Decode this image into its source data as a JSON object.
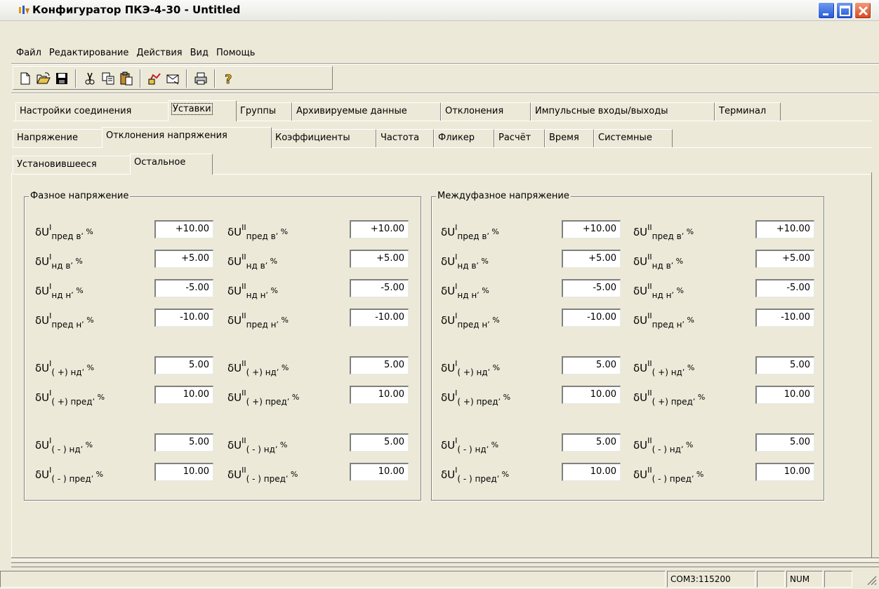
{
  "window": {
    "title": "Конфигуратор ПКЭ-4-30 - Untitled"
  },
  "menu": [
    "Файл",
    "Редактирование",
    "Действия",
    "Вид",
    "Помощь"
  ],
  "toolbar": {
    "icons": [
      "new-file-icon",
      "open-folder-icon",
      "save-icon",
      "cut-icon",
      "copy-icon",
      "paste-icon",
      "read-device-icon",
      "write-device-icon",
      "print-icon",
      "help-icon"
    ]
  },
  "tabs_main": [
    "Настройки соединения",
    "Уставки",
    "Группы",
    "Архивируемые данные",
    "Отклонения",
    "Импульсные входы/выходы",
    "Терминал"
  ],
  "tabs_sub": [
    "Напряжение",
    "Отклонения напряжения",
    "Коэффициенты",
    "Частота",
    "Фликер",
    "Расчёт",
    "Время",
    "Системные"
  ],
  "tabs_inner": [
    "Установившееся",
    "Остальное"
  ],
  "groups": {
    "phase": {
      "label": "Фазное напряжение",
      "values": {
        "pred_v_1": "+10.00",
        "pred_v_2": "+10.00",
        "nd_v_1": "+5.00",
        "nd_v_2": "+5.00",
        "nd_n_1": "-5.00",
        "nd_n_2": "-5.00",
        "pred_n_1": "-10.00",
        "pred_n_2": "-10.00",
        "plus_nd_1": "5.00",
        "plus_nd_2": "5.00",
        "plus_pred_1": "10.00",
        "plus_pred_2": "10.00",
        "minus_nd_1": "5.00",
        "minus_nd_2": "5.00",
        "minus_pred_1": "10.00",
        "minus_pred_2": "10.00"
      }
    },
    "interphase": {
      "label": "Междуфазное напряжение",
      "values": {
        "pred_v_1": "+10.00",
        "pred_v_2": "+10.00",
        "nd_v_1": "+5.00",
        "nd_v_2": "+5.00",
        "nd_n_1": "-5.00",
        "nd_n_2": "-5.00",
        "pred_n_1": "-10.00",
        "pred_n_2": "-10.00",
        "plus_nd_1": "5.00",
        "plus_nd_2": "5.00",
        "plus_pred_1": "10.00",
        "plus_pred_2": "10.00",
        "minus_nd_1": "5.00",
        "minus_nd_2": "5.00",
        "minus_pred_1": "10.00",
        "minus_pred_2": "10.00"
      }
    }
  },
  "labels": {
    "delta_u": "δU",
    "sup_1": "I",
    "sup_2": "II",
    "sub_pred_v": "пред  в",
    "sub_nd_v": "нд  в",
    "sub_nd_n": "нд  н",
    "sub_pred_n": "пред  н",
    "sub_plus_nd": "( +) нд",
    "sub_plus_pred": "( +) пред",
    "sub_minus_nd": "( - ) нд",
    "sub_minus_pred": "( - ) пред",
    "tail": ", %"
  },
  "status": {
    "port": "COM3:115200",
    "num": "NUM"
  }
}
